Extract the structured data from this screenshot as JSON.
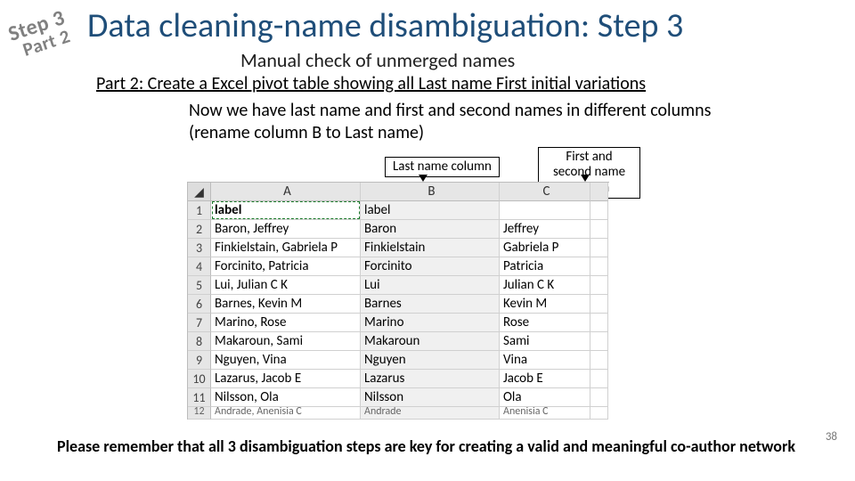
{
  "stamp": {
    "line1": "Step 3",
    "line2": "Part 2"
  },
  "title": "Data cleaning-name disambiguation: Step 3",
  "subtitle": "Manual check of unmerged names",
  "part_heading": "Part 2: Create a Excel pivot table showing all Last name First initial variations",
  "body": "Now we have last name and first and second names in different columns (rename column B to Last name)",
  "callout_lastname": "Last name column",
  "callout_firstsecond": "First and second name column",
  "table": {
    "cols": [
      "A",
      "B",
      "C",
      ""
    ],
    "rows": [
      {
        "n": "1",
        "a": "label",
        "b": "label",
        "c": ""
      },
      {
        "n": "2",
        "a": "Baron, Jeffrey",
        "b": "Baron",
        "c": "Jeffrey"
      },
      {
        "n": "3",
        "a": "Finkielstain, Gabriela P",
        "b": "Finkielstain",
        "c": "Gabriela P"
      },
      {
        "n": "4",
        "a": "Forcinito, Patricia",
        "b": "Forcinito",
        "c": "Patricia"
      },
      {
        "n": "5",
        "a": "Lui, Julian C K",
        "b": "Lui",
        "c": "Julian C K"
      },
      {
        "n": "6",
        "a": "Barnes, Kevin M",
        "b": "Barnes",
        "c": "Kevin M"
      },
      {
        "n": "7",
        "a": "Marino, Rose",
        "b": "Marino",
        "c": "Rose"
      },
      {
        "n": "8",
        "a": "Makaroun, Sami",
        "b": "Makaroun",
        "c": "Sami"
      },
      {
        "n": "9",
        "a": "Nguyen, Vina",
        "b": "Nguyen",
        "c": "Vina"
      },
      {
        "n": "10",
        "a": "Lazarus, Jacob E",
        "b": "Lazarus",
        "c": "Jacob E"
      },
      {
        "n": "11",
        "a": "Nilsson, Ola",
        "b": "Nilsson",
        "c": "Ola"
      }
    ],
    "trunc": {
      "n": "12",
      "a": "Andrade, Anenisia C",
      "b": "Andrade",
      "c": "Anenisia C"
    }
  },
  "footer": "Please remember that all 3 disambiguation steps are key for creating a valid and meaningful co-author network",
  "page_number": "38"
}
